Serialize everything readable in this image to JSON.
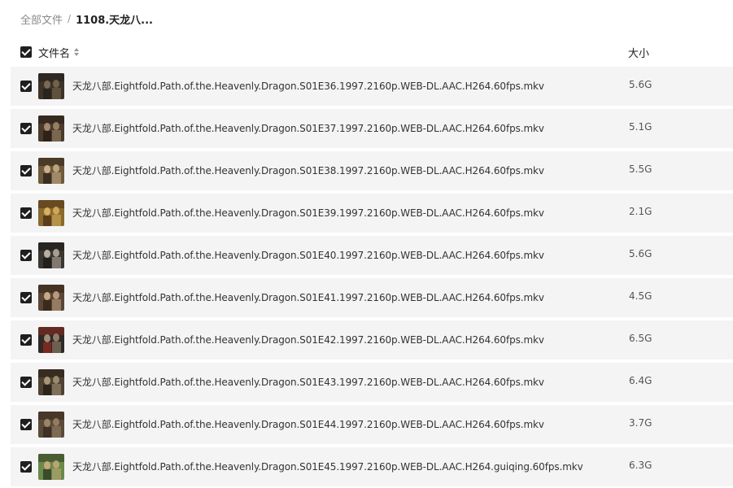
{
  "breadcrumb": {
    "root": "全部文件",
    "separator": "/",
    "current": "1108.天龙八..."
  },
  "header": {
    "name_label": "文件名",
    "size_label": "大小",
    "select_all_checked": true
  },
  "files": [
    {
      "name": "天龙八部.Eightfold.Path.of.the.Heavenly.Dragon.S01E36.1997.2160p.WEB-DL.AAC.H264.60fps.mkv",
      "size": "5.6G",
      "checked": true,
      "thumb_colors": [
        "#3d3326",
        "#7b6a52",
        "#2a2420"
      ]
    },
    {
      "name": "天龙八部.Eightfold.Path.of.the.Heavenly.Dragon.S01E37.1997.2160p.WEB-DL.AAC.H264.60fps.mkv",
      "size": "5.1G",
      "checked": true,
      "thumb_colors": [
        "#4a3a2c",
        "#a48a6c",
        "#2e2218"
      ]
    },
    {
      "name": "天龙八部.Eightfold.Path.of.the.Heavenly.Dragon.S01E38.1997.2160p.WEB-DL.AAC.H264.60fps.mkv",
      "size": "5.5G",
      "checked": true,
      "thumb_colors": [
        "#6e5a3c",
        "#c9b08a",
        "#3a2e20"
      ]
    },
    {
      "name": "天龙八部.Eightfold.Path.of.the.Heavenly.Dragon.S01E39.1997.2160p.WEB-DL.AAC.H264.60fps.mkv",
      "size": "2.1G",
      "checked": true,
      "thumb_colors": [
        "#8a6a2e",
        "#d8b060",
        "#5a3e1c"
      ]
    },
    {
      "name": "天龙八部.Eightfold.Path.of.the.Heavenly.Dragon.S01E40.1997.2160p.WEB-DL.AAC.H264.60fps.mkv",
      "size": "5.6G",
      "checked": true,
      "thumb_colors": [
        "#3a3630",
        "#b8b0a4",
        "#22201c"
      ]
    },
    {
      "name": "天龙八部.Eightfold.Path.of.the.Heavenly.Dragon.S01E41.1997.2160p.WEB-DL.AAC.H264.60fps.mkv",
      "size": "4.5G",
      "checked": true,
      "thumb_colors": [
        "#5a4636",
        "#c8a888",
        "#3a2a1e"
      ]
    },
    {
      "name": "天龙八部.Eightfold.Path.of.the.Heavenly.Dragon.S01E42.1997.2160p.WEB-DL.AAC.H264.60fps.mkv",
      "size": "6.5G",
      "checked": true,
      "thumb_colors": [
        "#2e2a26",
        "#a08c74",
        "#7a2a22"
      ]
    },
    {
      "name": "天龙八部.Eightfold.Path.of.the.Heavenly.Dragon.S01E43.1997.2160p.WEB-DL.AAC.H264.60fps.mkv",
      "size": "6.4G",
      "checked": true,
      "thumb_colors": [
        "#4e4232",
        "#a89678",
        "#2c2418"
      ]
    },
    {
      "name": "天龙八部.Eightfold.Path.of.the.Heavenly.Dragon.S01E44.1997.2160p.WEB-DL.AAC.H264.60fps.mkv",
      "size": "3.7G",
      "checked": true,
      "thumb_colors": [
        "#5a4a3a",
        "#9c8466",
        "#3e3024"
      ]
    },
    {
      "name": "天龙八部.Eightfold.Path.of.the.Heavenly.Dragon.S01E45.1997.2160p.WEB-DL.AAC.H264.guiqing.60fps.mkv",
      "size": "6.3G",
      "checked": true,
      "thumb_colors": [
        "#6a8a4a",
        "#c8a878",
        "#3a4a2a"
      ]
    }
  ]
}
